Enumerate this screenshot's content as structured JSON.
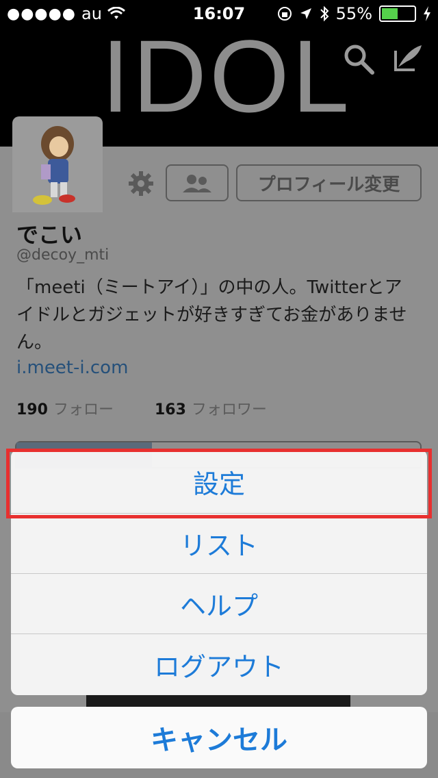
{
  "status_bar": {
    "signal_dots": "●●●●●",
    "carrier": "au",
    "time": "16:07",
    "battery_percent": "55%",
    "battery_level": 0.55
  },
  "header": {
    "title": "IDOL"
  },
  "profile": {
    "name": "でこい",
    "handle": "@decoy_mti",
    "bio": "「meeti（ミートアイ）」の中の人。Twitterとアイドルとガジェットが好きすぎてお金がありません。",
    "link": "i.meet-i.com",
    "following_count": "190",
    "following_label": "フォロー",
    "followers_count": "163",
    "followers_label": "フォロワー",
    "edit_profile_label": "プロフィール変更"
  },
  "action_sheet": {
    "items": [
      {
        "label": "設定"
      },
      {
        "label": "リスト"
      },
      {
        "label": "ヘルプ"
      },
      {
        "label": "ログアウト"
      }
    ],
    "cancel_label": "キャンセル"
  },
  "colors": {
    "accent": "#1d7bd8",
    "highlight": "#e8302f",
    "battery": "#55d14b"
  }
}
